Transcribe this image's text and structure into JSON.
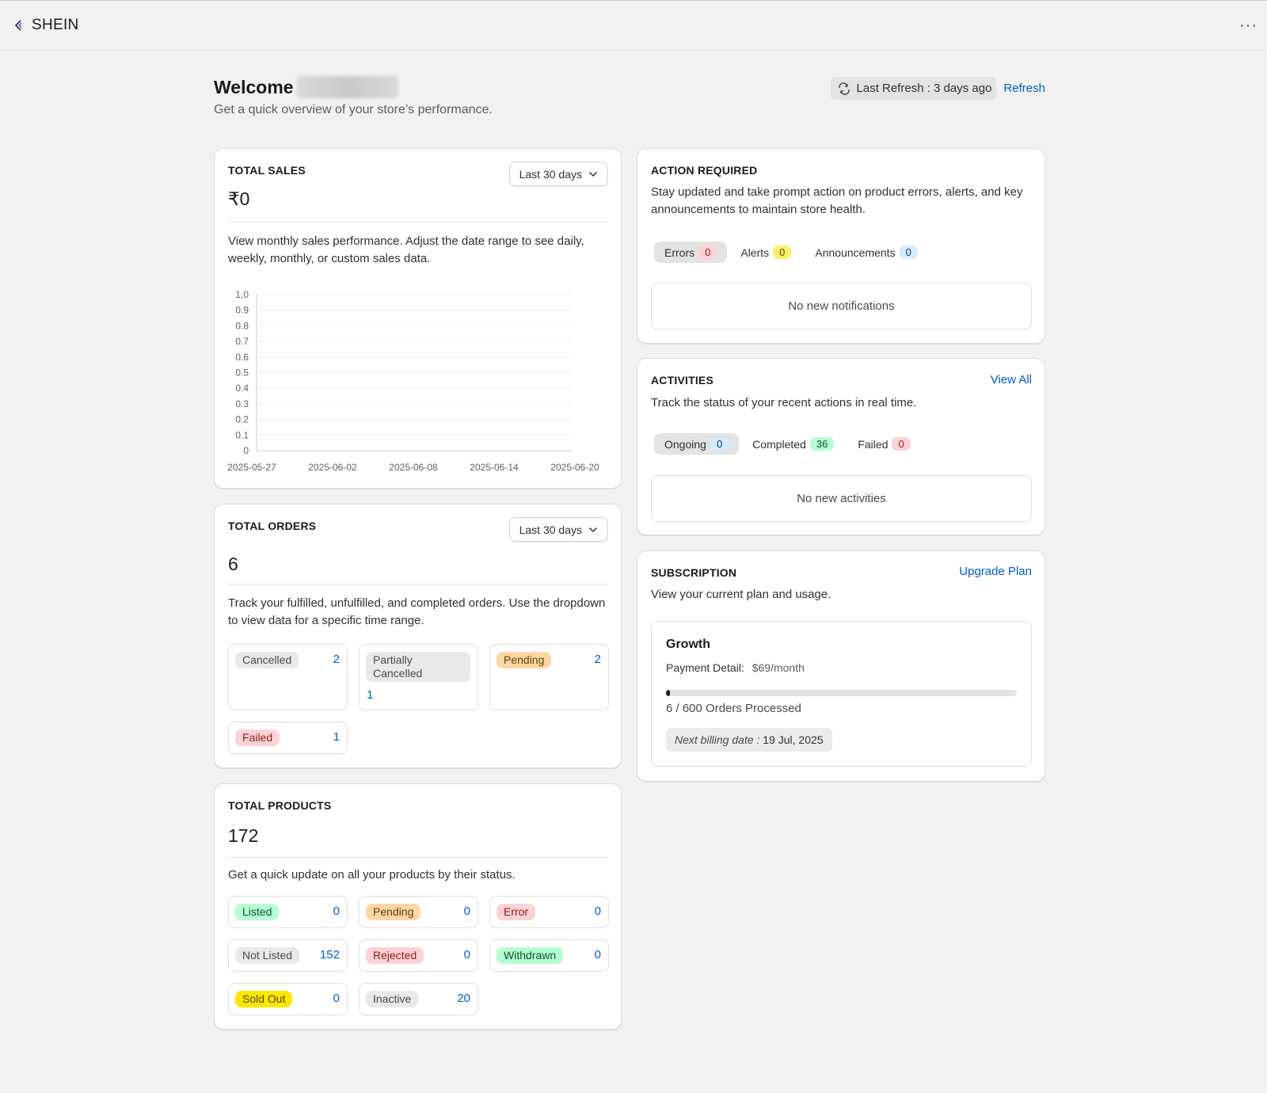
{
  "app": {
    "name": "SHEIN",
    "more": "···"
  },
  "header": {
    "welcome": "Welcome",
    "subtitle": "Get a quick overview of your store’s performance.",
    "last_refresh": "Last Refresh : 3 days ago",
    "refresh_link": "Refresh"
  },
  "total_sales": {
    "title": "TOTAL SALES",
    "range": "Last 30 days",
    "value": "₹0",
    "description": "View monthly sales performance. Adjust the date range to see daily, weekly, monthly, or custom sales data."
  },
  "chart_data": {
    "type": "line",
    "title": "",
    "xlabel": "",
    "ylabel": "",
    "x": [
      "2025-05-27",
      "2025-06-02",
      "2025-06-08",
      "2025-06-14",
      "2025-06-20"
    ],
    "y_ticks": [
      "1.0",
      "0.9",
      "0.8",
      "0.7",
      "0.6",
      "0.5",
      "0.4",
      "0.3",
      "0.2",
      "0.1",
      "0"
    ],
    "ylim": [
      0,
      1
    ],
    "series": [],
    "grid": true
  },
  "total_orders": {
    "title": "TOTAL ORDERS",
    "range": "Last 30 days",
    "value": "6",
    "description": "Track your fulfilled, unfulfilled, and completed orders. Use the dropdown to view data for a specific time range.",
    "tiles": [
      {
        "label": "Cancelled",
        "count": "2"
      },
      {
        "label": "Partially Cancelled",
        "count": "1"
      },
      {
        "label": "Pending",
        "count": "2"
      },
      {
        "label": "Failed",
        "count": "1"
      }
    ]
  },
  "total_products": {
    "title": "TOTAL PRODUCTS",
    "value": "172",
    "description": "Get a quick update on all your products by their status.",
    "tiles": [
      {
        "label": "Listed",
        "count": "0"
      },
      {
        "label": "Pending",
        "count": "0"
      },
      {
        "label": "Error",
        "count": "0"
      },
      {
        "label": "Not Listed",
        "count": "152"
      },
      {
        "label": "Rejected",
        "count": "0"
      },
      {
        "label": "Withdrawn",
        "count": "0"
      },
      {
        "label": "Sold Out",
        "count": "0"
      },
      {
        "label": "Inactive",
        "count": "20"
      }
    ]
  },
  "action_required": {
    "title": "ACTION REQUIRED",
    "description": "Stay updated and take prompt action on product errors, alerts, and key announcements to maintain store health.",
    "tabs": [
      {
        "label": "Errors",
        "count": "0"
      },
      {
        "label": "Alerts",
        "count": "0"
      },
      {
        "label": "Announcements",
        "count": "0"
      }
    ],
    "empty": "No new notifications"
  },
  "activities": {
    "title": "ACTIVITIES",
    "view_all": "View All",
    "description": "Track the status of your recent actions in real time.",
    "tabs": [
      {
        "label": "Ongoing",
        "count": "0"
      },
      {
        "label": "Completed",
        "count": "36"
      },
      {
        "label": "Failed",
        "count": "0"
      }
    ],
    "empty": "No new activities"
  },
  "subscription": {
    "title": "SUBSCRIPTION",
    "upgrade": "Upgrade Plan",
    "description": "View your current plan and usage.",
    "plan": "Growth",
    "payment_label": "Payment Detail:",
    "payment_value": "$69/month",
    "orders_used": 6,
    "orders_limit": 600,
    "orders_text": "6 / 600 Orders Processed",
    "billing_label": "Next billing date :",
    "billing_date": "19 Jul, 2025"
  },
  "colors": {
    "link": "#005bd3",
    "badge_gray": "#e9e9e9",
    "badge_orange": "#ffd6a4",
    "badge_red": "#fed1d7",
    "badge_green": "#b4fed2",
    "badge_yellow": "#ffe600",
    "count_blue": "#d5ebff"
  }
}
